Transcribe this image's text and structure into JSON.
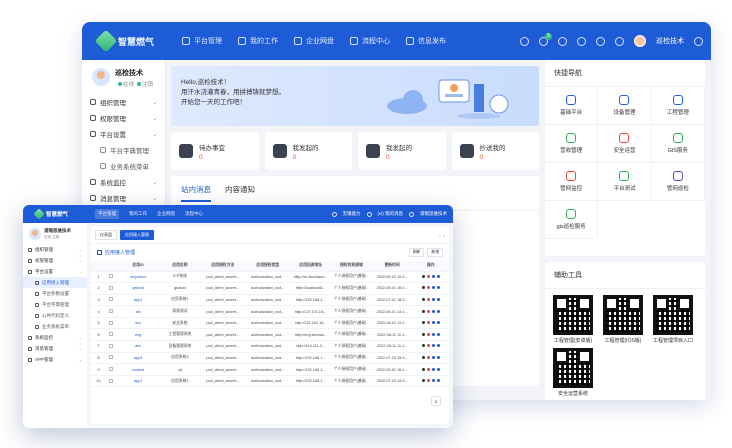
{
  "back": {
    "logo_text": "智慧燃气",
    "nav": [
      {
        "label": "平台管理",
        "icon": "gear-icon"
      },
      {
        "label": "我的工作",
        "icon": "monitor-icon"
      },
      {
        "label": "企业网盘",
        "icon": "cloud-icon"
      },
      {
        "label": "流程中心",
        "icon": "flow-icon"
      },
      {
        "label": "信息发布",
        "icon": "broadcast-icon"
      }
    ],
    "notif_badge": "5",
    "user_label": "巡检技术",
    "sidebar": {
      "user_name": "巡检技术",
      "status_online": "在线",
      "status_logout": "注销",
      "menu": [
        {
          "label": "组织管理",
          "sub": false
        },
        {
          "label": "权限管理",
          "sub": false
        },
        {
          "label": "平台设置",
          "sub": false
        },
        {
          "label": "平台字典管理",
          "sub": true
        },
        {
          "label": "业务系统菜单",
          "sub": true
        },
        {
          "label": "系统监控",
          "sub": false
        },
        {
          "label": "消息管理",
          "sub": false
        },
        {
          "label": "APP管理",
          "sub": false
        }
      ]
    },
    "banner": {
      "line1": "Hello,巡检技术！",
      "line2": "用汗水浇灌青春，用拼搏铸就梦想。",
      "line3": "开始您一天的工作吧！"
    },
    "cards": [
      {
        "label": "待办事宜",
        "value": "0"
      },
      {
        "label": "我发起的",
        "value": "0"
      },
      {
        "label": "我发起的",
        "value": "0"
      },
      {
        "label": "抄送我的",
        "value": "0"
      }
    ],
    "msg_tabs": [
      "站内消息",
      "内容通知"
    ],
    "quick_nav": {
      "title": "快捷导航",
      "items": [
        {
          "label": "基础平台",
          "color": "blue"
        },
        {
          "label": "设备管理",
          "color": "blue"
        },
        {
          "label": "工程管理",
          "color": "blue"
        },
        {
          "label": "营收管理",
          "color": "green"
        },
        {
          "label": "安全运营",
          "color": "red"
        },
        {
          "label": "GIS服务",
          "color": "green"
        },
        {
          "label": "管网监控",
          "color": "red"
        },
        {
          "label": "平台测试",
          "color": "green"
        },
        {
          "label": "管网巡检",
          "color": "purple"
        },
        {
          "label": "gis巡检服务",
          "color": "green"
        }
      ]
    },
    "tools": {
      "title": "辅助工具",
      "qrs": [
        "工程管理(安卓版)",
        "工程管理(IOS版)",
        "工程管理项目入口",
        "安全运营系统"
      ]
    }
  },
  "front": {
    "logo_text": "智慧燃气",
    "nav": [
      "平台管理",
      "我的工作",
      "企业网盘",
      "流程中心"
    ],
    "right": [
      "无锡能力",
      "(vi) 我的消息",
      "浦锡思维技术"
    ],
    "sidebar": {
      "user_name": "浦锡思维技术",
      "status_online": "在线",
      "status_logout": "注销",
      "menu": [
        {
          "label": "组织管理",
          "sub": false,
          "active": false
        },
        {
          "label": "权限管理",
          "sub": false,
          "active": false
        },
        {
          "label": "平台设置",
          "sub": false,
          "active": false
        },
        {
          "label": "应用接入管理",
          "sub": true,
          "active": true
        },
        {
          "label": "平台参数设置",
          "sub": true,
          "active": false
        },
        {
          "label": "平台字典管理",
          "sub": true,
          "active": false
        },
        {
          "label": "公共代码定义",
          "sub": true,
          "active": false
        },
        {
          "label": "业务系统菜单",
          "sub": true,
          "active": false
        },
        {
          "label": "系统监控",
          "sub": false,
          "active": false
        },
        {
          "label": "消息管理",
          "sub": false,
          "active": false
        },
        {
          "label": "APP管理",
          "sub": false,
          "active": false
        }
      ]
    },
    "tabs": [
      "仪表盘",
      "应用接入管理"
    ],
    "page_title": "应用接入管理",
    "btn_refresh": "刷新",
    "btn_add": "新增",
    "table": {
      "headers": [
        "",
        "",
        "应用ID",
        "应用名称",
        "应用授权方法",
        "应用授权类型",
        "应用回调地址",
        "授权的资源域",
        "更新时间",
        "操作"
      ],
      "rows": [
        [
          "1",
          "",
          "wxyzdzcf",
          "ICP系统",
          "pcd_client_secret...",
          "authorization_cod...",
          "http://xn.zku/wanx...",
          "个人授权用户(基础...",
          "2022-09-22 10:3..."
        ],
        [
          "2",
          "",
          "gisfuwl",
          "gisfuwl",
          "pcd_client_secret...",
          "authorization_cod...",
          "http://localhost8...",
          "个人授权用户(基础...",
          "2022-09-01 16:0..."
        ],
        [
          "3",
          "",
          "app1",
          "应用系统1",
          "pcd_client_secret...",
          "authorization_cod...",
          "http://192.168.1...",
          "个人授权用户(基础...",
          "2022-07-01 18:3..."
        ],
        [
          "4",
          "",
          "afc",
          "表规测试",
          "pcd_client_secret...",
          "authorization_cod...",
          "http://127.0.0.1:8...",
          "个人授权用户(基础...",
          "2022-06-01 14:1..."
        ],
        [
          "5",
          "",
          "ssc",
          "安全系统",
          "pcd_client_secret...",
          "authorization_cod...",
          "http://221.162.16...",
          "个人授权用户(基础...",
          "2022-06-01 11:1..."
        ],
        [
          "6",
          "",
          "eng",
          "工程管理系统",
          "pcd_client_secret...",
          "authorization_cod...",
          "http://eng.zku/wa...",
          "个人授权用户(基础...",
          "2022-06-11 11:1..."
        ],
        [
          "7",
          "",
          "dev",
          "设备管理系统",
          "pcd_client_secret...",
          "authorization_cod...",
          "http://114.111.0...",
          "个人授权用户(基础...",
          "2022-06-11 11:1..."
        ],
        [
          "8",
          "",
          "app3",
          "应用系统3",
          "pcd_client_secret...",
          "authorization_cod...",
          "http://192.168.1...",
          "个人授权用户(基础...",
          "2022-07-23 15:3..."
        ],
        [
          "9",
          "",
          "localist",
          "cjt",
          "pcd_client_secret...",
          "authorization_cod...",
          "http://192.168.1...",
          "个人授权用户(基础...",
          "2022-06-01 16:1..."
        ],
        [
          "10",
          "",
          "app1",
          "应用系统1",
          "pcd_client_secret...",
          "authorization_cod...",
          "http://192.168.1...",
          "个人授权用户(基础...",
          "2022-07-23 15:3..."
        ]
      ]
    },
    "page_num": "1"
  }
}
